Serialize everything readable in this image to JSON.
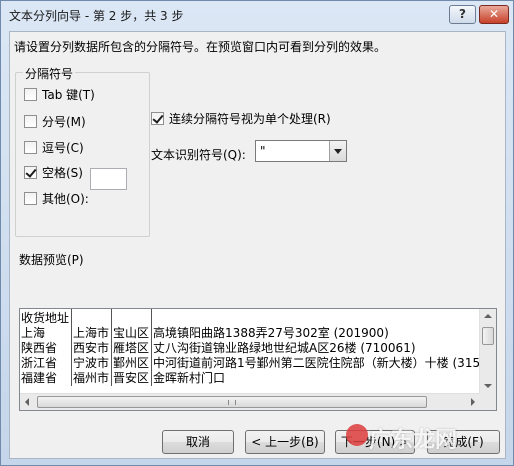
{
  "window": {
    "title": "文本分列向导 - 第 2 步，共 3 步",
    "help_label": "?",
    "close_label": "✕"
  },
  "instruction": "请设置分列数据所包含的分隔符号。在预览窗口内可看到分列的效果。",
  "delimiters": {
    "group_title": "分隔符号",
    "items": [
      {
        "label": "Tab 键(T)",
        "checked": false
      },
      {
        "label": "分号(M)",
        "checked": false
      },
      {
        "label": "逗号(C)",
        "checked": false
      },
      {
        "label": "空格(S)",
        "checked": true
      },
      {
        "label": "其他(O):",
        "checked": false
      }
    ],
    "other_value": ""
  },
  "consecutive": {
    "label": "连续分隔符号视为单个处理(R)",
    "checked": true
  },
  "text_qualifier": {
    "label": "文本识别符号(Q):",
    "value": "\""
  },
  "preview": {
    "label": "数据预览(P)",
    "rows": [
      [
        "收货地址",
        "",
        "",
        ""
      ],
      [
        "上海",
        "上海市",
        "宝山区",
        "高境镇阳曲路1388弄27号302室 (201900)"
      ],
      [
        "陕西省",
        "西安市",
        "雁塔区",
        "丈八沟街道锦业路绿地世纪城A区26楼 (710061)"
      ],
      [
        "浙江省",
        "宁波市",
        "鄞州区",
        "中河街道前河路1号鄞州第二医院住院部（新大楼）十楼 (315"
      ],
      [
        "福建省",
        "福州市",
        "晋安区",
        "金晖新村门口"
      ]
    ]
  },
  "buttons": {
    "cancel": "取消",
    "back": "< 上一步(B)",
    "next": "下一步(N) >",
    "finish": "完成(F)"
  },
  "watermark": "广东龙网"
}
